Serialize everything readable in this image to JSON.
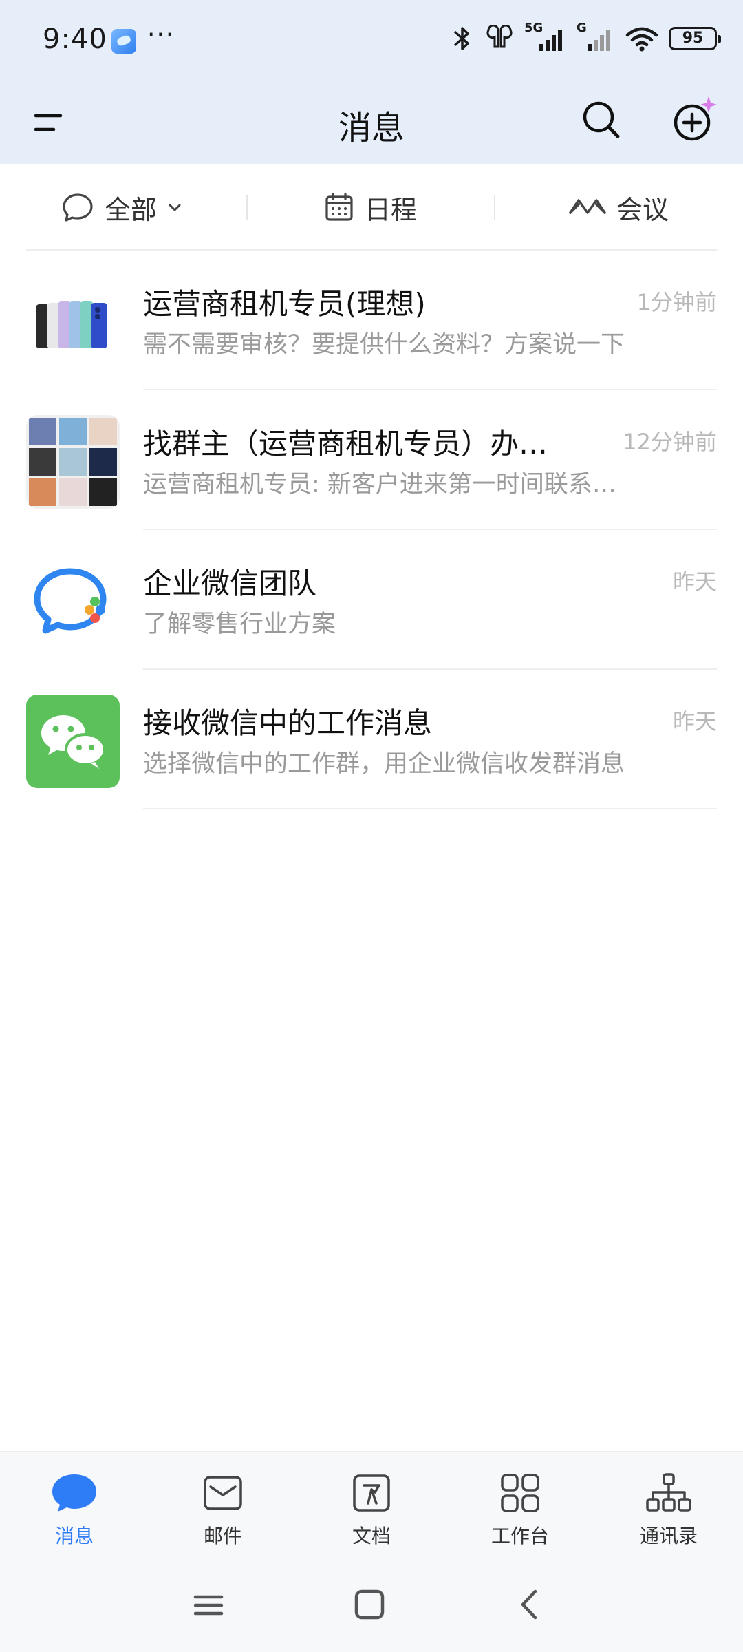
{
  "status_bar": {
    "time": "9:40",
    "more": "···",
    "network_5g": "5G",
    "network_g": "G",
    "battery": "95"
  },
  "header": {
    "title": "消息"
  },
  "filters": [
    {
      "label": "全部",
      "icon": "chat-bubble-icon"
    },
    {
      "label": "日程",
      "icon": "calendar-icon"
    },
    {
      "label": "会议",
      "icon": "meeting-icon"
    }
  ],
  "messages": [
    {
      "title": "运营商租机专员(理想)",
      "time": "1分钟前",
      "preview": "需不需要审核？要提供什么资料？方案说一下",
      "avatar": "phones-image"
    },
    {
      "title": "找群主（运营商租机专员）办…",
      "time": "12分钟前",
      "preview": "运营商租机专员: 新客户进来第一时间联系…",
      "avatar": "group-collage"
    },
    {
      "title": "企业微信团队",
      "time": "昨天",
      "preview": "了解零售行业方案",
      "avatar": "wecom-logo"
    },
    {
      "title": "接收微信中的工作消息",
      "time": "昨天",
      "preview": "选择微信中的工作群，用企业微信收发群消息",
      "avatar": "wechat-logo"
    }
  ],
  "tabs": [
    {
      "label": "消息",
      "icon": "message-icon",
      "active": true
    },
    {
      "label": "邮件",
      "icon": "mail-icon",
      "active": false
    },
    {
      "label": "文档",
      "icon": "document-icon",
      "active": false
    },
    {
      "label": "工作台",
      "icon": "workbench-icon",
      "active": false
    },
    {
      "label": "通讯录",
      "icon": "contacts-icon",
      "active": false
    }
  ],
  "colors": {
    "header_bg": "#e6eefa",
    "accent": "#2e7cf6",
    "wechat_green": "#5cc15b"
  }
}
